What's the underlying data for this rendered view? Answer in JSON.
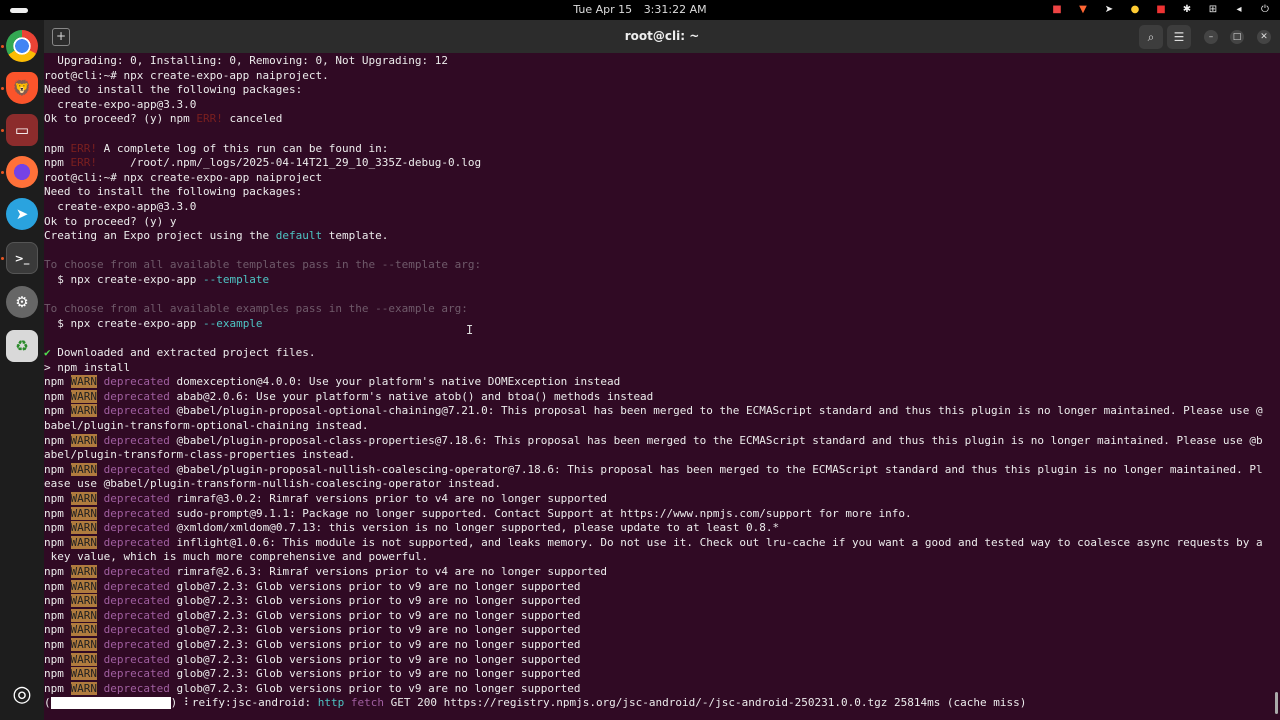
{
  "topbar": {
    "date": "Tue Apr 15",
    "time": "3:31:22 AM"
  },
  "window": {
    "title": "root@cli: ~"
  },
  "dock": {
    "apps": [
      "chrome-icon",
      "brave-icon",
      "files-icon",
      "firefox-icon",
      "telegram-icon",
      "terminal-icon",
      "settings-icon",
      "trash-icon",
      "ubuntu-icon"
    ]
  },
  "terminal": {
    "lines": [
      "  Upgrading: 0, Installing: 0, Removing: 0, Not Upgrading: 12",
      "root@cli:~# npx create-expo-app naiproject.",
      "Need to install the following packages:",
      "  create-expo-app@3.3.0",
      "Ok to proceed? (y) npm ERR! canceled",
      "",
      "npm ERR! A complete log of this run can be found in:",
      "npm ERR!     /root/.npm/_logs/2025-04-14T21_29_10_335Z-debug-0.log",
      "root@cli:~# npx create-expo-app naiproject",
      "Need to install the following packages:",
      "  create-expo-app@3.3.0",
      "Ok to proceed? (y) y",
      "Creating an Expo project using the default template.",
      "",
      "To choose from all available templates pass in the --template arg:",
      "  $ npx create-expo-app --template",
      "",
      "To choose from all available examples pass in the --example arg:",
      "  $ npx create-expo-app --example",
      "",
      "✔ Downloaded and extracted project files.",
      "> npm install",
      "npm WARN deprecated domexception@4.0.0: Use your platform's native DOMException instead",
      "npm WARN deprecated abab@2.0.6: Use your platform's native atob() and btoa() methods instead",
      "npm WARN deprecated @babel/plugin-proposal-optional-chaining@7.21.0: This proposal has been merged to the ECMAScript standard and thus this plugin is no longer maintained. Please use @",
      "babel/plugin-transform-optional-chaining instead.",
      "npm WARN deprecated @babel/plugin-proposal-class-properties@7.18.6: This proposal has been merged to the ECMAScript standard and thus this plugin is no longer maintained. Please use @b",
      "abel/plugin-transform-class-properties instead.",
      "npm WARN deprecated @babel/plugin-proposal-nullish-coalescing-operator@7.18.6: This proposal has been merged to the ECMAScript standard and thus this plugin is no longer maintained. Pl",
      "ease use @babel/plugin-transform-nullish-coalescing-operator instead.",
      "npm WARN deprecated rimraf@3.0.2: Rimraf versions prior to v4 are no longer supported",
      "npm WARN deprecated sudo-prompt@9.1.1: Package no longer supported. Contact Support at https://www.npmjs.com/support for more info.",
      "npm WARN deprecated @xmldom/xmldom@0.7.13: this version is no longer supported, please update to at least 0.8.*",
      "npm WARN deprecated inflight@1.0.6: This module is not supported, and leaks memory. Do not use it. Check out lru-cache if you want a good and tested way to coalesce async requests by a",
      " key value, which is much more comprehensive and powerful.",
      "npm WARN deprecated rimraf@2.6.3: Rimraf versions prior to v4 are no longer supported",
      "npm WARN deprecated glob@7.2.3: Glob versions prior to v9 are no longer supported",
      "npm WARN deprecated glob@7.2.3: Glob versions prior to v9 are no longer supported",
      "npm WARN deprecated glob@7.2.3: Glob versions prior to v9 are no longer supported",
      "npm WARN deprecated glob@7.2.3: Glob versions prior to v9 are no longer supported",
      "npm WARN deprecated glob@7.2.3: Glob versions prior to v9 are no longer supported",
      "npm WARN deprecated glob@7.2.3: Glob versions prior to v9 are no longer supported",
      "npm WARN deprecated glob@7.2.3: Glob versions prior to v9 are no longer supported",
      "npm WARN deprecated glob@7.2.3: Glob versions prior to v9 are no longer supported"
    ],
    "progress_line": ") ⠇reify:jsc-android: http fetch GET 200 https://registry.npmjs.org/jsc-android/-/jsc-android-250231.0.0.tgz 25814ms (cache miss)"
  },
  "colors": {
    "terminal_bg": "#300a24",
    "warn_bg": "#b07b3e",
    "deprecated": "#a05fa0",
    "error": "#7a1f1f"
  }
}
